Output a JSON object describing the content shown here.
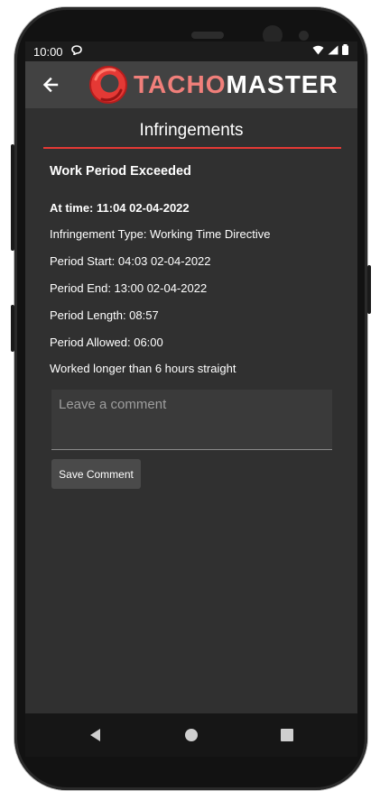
{
  "status_bar": {
    "time": "10:00",
    "notification_icon": "chat-bubble-icon",
    "icons": [
      "wifi-icon",
      "signal-icon",
      "battery-icon"
    ]
  },
  "app_bar": {
    "back_icon": "arrow-left-icon",
    "logo_text_a": "TACHO",
    "logo_text_b": "MASTER",
    "logo_color": "#f07f7a"
  },
  "page": {
    "title": "Infringements",
    "accent_color": "#e53935"
  },
  "infringement": {
    "heading": "Work Period Exceeded",
    "at_time": "At time: 11:04 02-04-2022",
    "type": "Infringement Type: Working Time Directive",
    "period_start": "Period Start: 04:03 02-04-2022",
    "period_end": "Period End: 13:00 02-04-2022",
    "period_length": "Period Length: 08:57",
    "period_allowed": "Period Allowed: 06:00",
    "description": "Worked longer than 6 hours straight"
  },
  "comment": {
    "placeholder": "Leave a comment",
    "value": "",
    "save_label": "Save Comment"
  },
  "nav_bar": {
    "items": [
      "back-triangle-icon",
      "home-circle-icon",
      "recents-square-icon"
    ]
  }
}
